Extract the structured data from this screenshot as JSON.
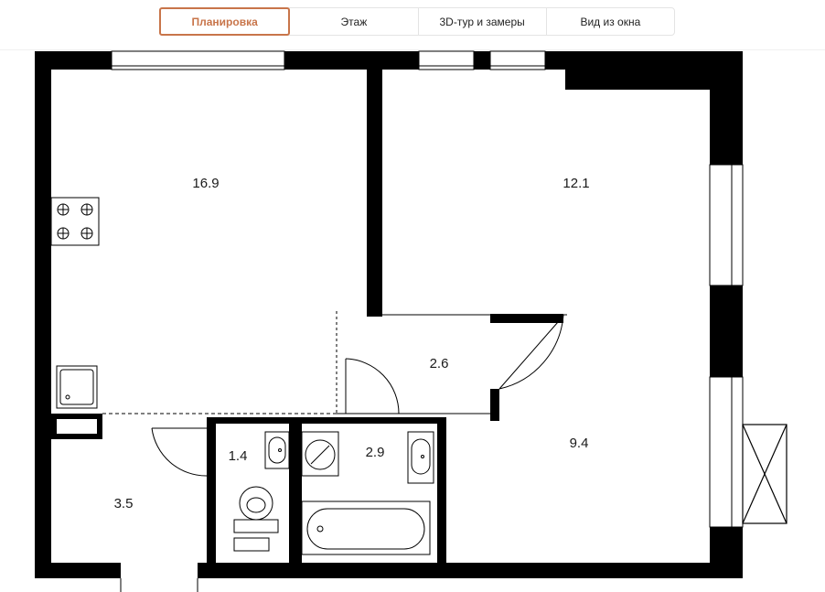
{
  "tabs": [
    {
      "label": "Планировка",
      "active": true
    },
    {
      "label": "Этаж",
      "active": false
    },
    {
      "label": "3D-тур и замеры",
      "active": false
    },
    {
      "label": "Вид из окна",
      "active": false
    }
  ],
  "accent_color": "#c8754a",
  "rooms": [
    {
      "id": "kitchen-living",
      "area": "16.9"
    },
    {
      "id": "bedroom",
      "area": "12.1"
    },
    {
      "id": "hall",
      "area": "2.6"
    },
    {
      "id": "room-lower-right",
      "area": "9.4"
    },
    {
      "id": "wc",
      "area": "1.4"
    },
    {
      "id": "bathroom",
      "area": "2.9"
    },
    {
      "id": "entrance",
      "area": "3.5"
    }
  ],
  "icons": [
    "stove-icon",
    "sink-icon",
    "washbasin-icon",
    "toilet-icon",
    "washing-machine-icon",
    "bathtub-icon",
    "window-icon",
    "balcony-icon"
  ]
}
